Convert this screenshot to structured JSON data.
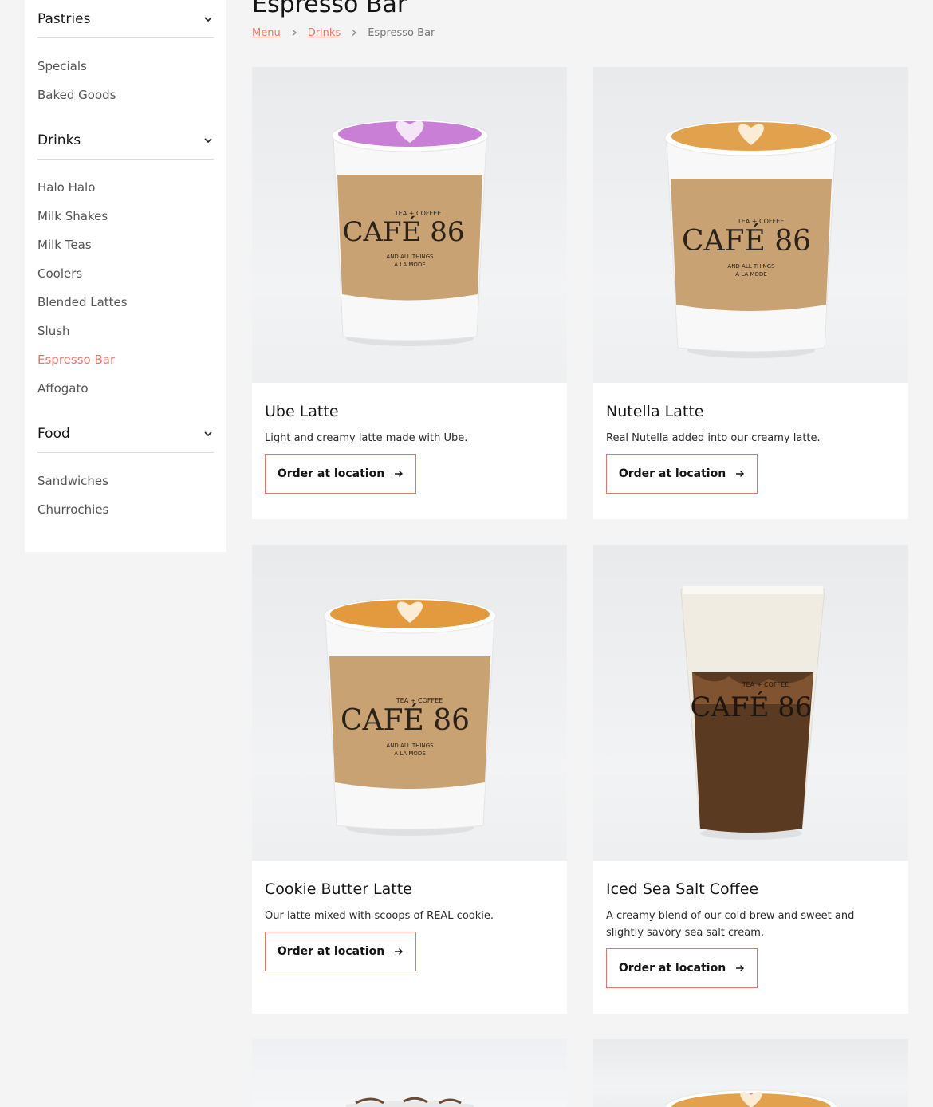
{
  "sidebar": {
    "categories": [
      {
        "title": "Pastries",
        "items": [
          "Specials",
          "Baked Goods"
        ]
      },
      {
        "title": "Drinks",
        "items": [
          "Halo Halo",
          "Milk Shakes",
          "Milk Teas",
          "Coolers",
          "Blended Lattes",
          "Slush",
          "Espresso Bar",
          "Affogato"
        ]
      },
      {
        "title": "Food",
        "items": [
          "Sandwiches",
          "Churrochies"
        ]
      }
    ],
    "active_item": "Espresso Bar"
  },
  "page": {
    "title": "Espresso Bar",
    "breadcrumb": [
      "Menu",
      "Drinks",
      "Espresso Bar"
    ]
  },
  "products": [
    {
      "name": "Ube Latte",
      "description": "Light and creamy latte made with Ube.",
      "button": "Order at location",
      "foam_color": "#c97fd6",
      "cup": "hot"
    },
    {
      "name": "Nutella Latte",
      "description": "Real Nutella added into our creamy latte.",
      "button": "Order at location",
      "foam_color": "#e2a14c",
      "cup": "hot"
    },
    {
      "name": "Cookie Butter Latte",
      "description": "Our latte mixed with scoops of REAL cookie.",
      "button": "Order at location",
      "foam_color": "#e39a3f",
      "cup": "hot"
    },
    {
      "name": "Iced Sea Salt Coffee",
      "description": "A creamy blend of our cold brew and sweet and slightly savory sea salt cream.",
      "button": "Order at location",
      "cup": "iced"
    }
  ],
  "cup_sleeve_text": {
    "top": "TEA + COFFEE",
    "brand": "CAFÉ 86",
    "bottom1": "AND ALL THINGS",
    "bottom2": "A LA MODE"
  },
  "colors": {
    "accent": "#e4776a",
    "background": "#f4f4f4",
    "card": "#ffffff"
  }
}
